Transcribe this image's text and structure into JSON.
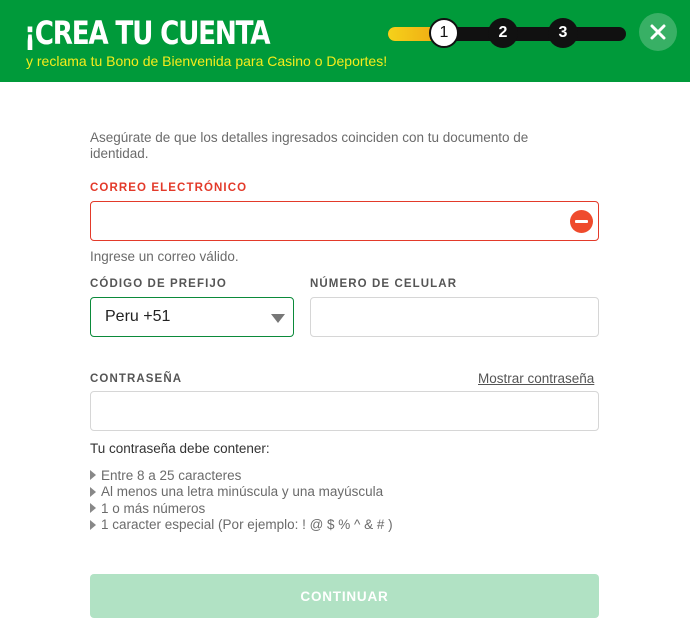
{
  "header": {
    "title": "¡CREA TU CUENTA",
    "subtitle": "y reclama tu Bono de Bienvenida para Casino o Deportes!",
    "background_color": "#009a3a",
    "subtitle_color": "#f5ec1c"
  },
  "stepper": {
    "steps": [
      "1",
      "2",
      "3"
    ],
    "current_step": 1,
    "progress_fraction": 0.22
  },
  "close": {
    "icon": "close-icon"
  },
  "form": {
    "intro": "Asegúrate de que los detalles ingresados coinciden con tu documento de identidad.",
    "email": {
      "label": "CORREO ELECTRÓNICO",
      "value": "",
      "placeholder": "",
      "error_icon": "minus-circle-icon",
      "helper": "Ingrese un correo válido."
    },
    "prefix": {
      "label": "CÓDIGO DE PREFIJO",
      "selected": "Peru +51"
    },
    "phone": {
      "label": "NÚMERO DE CELULAR",
      "value": "",
      "placeholder": ""
    },
    "password": {
      "label": "CONTRASEÑA",
      "show_label": "Mostrar contraseña",
      "value": "",
      "placeholder": ""
    },
    "rules_title": "Tu contraseña debe contener:",
    "rules": [
      "Entre 8 a 25 caracteres",
      "Al menos una letra minúscula y una mayúscula",
      "1 o más números",
      "1 caracter especial (Por ejemplo: ! @ $ % ^ & # )"
    ],
    "continue_label": "CONTINUAR"
  },
  "colors": {
    "error": "#e33a2a",
    "accent_green": "#0b8a3a",
    "button_disabled": "#b1e2c4"
  }
}
